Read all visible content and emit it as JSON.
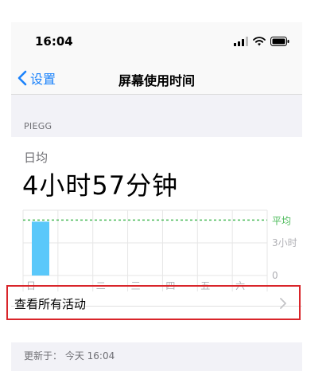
{
  "status_bar": {
    "time": "16:04"
  },
  "nav": {
    "back_label": "设置",
    "title": "屏幕使用时间"
  },
  "section_header": "PIEGG",
  "summary": {
    "label": "日均",
    "value": "4小时57分钟"
  },
  "chart_data": {
    "type": "bar",
    "categories": [
      "日",
      "一",
      "二",
      "三",
      "四",
      "五",
      "六"
    ],
    "values": [
      4.95,
      0,
      0,
      0,
      0,
      0,
      0
    ],
    "average_value": 4.95,
    "average_label": "平均",
    "y_tick_labels": [
      "3小时",
      "0"
    ],
    "ylim": [
      0,
      6
    ],
    "colors": {
      "bar": "#5ac8fa",
      "average_line": "#4cbb5a",
      "grid": "#e6e6e6"
    }
  },
  "view_all": {
    "label": "查看所有活动"
  },
  "updated": {
    "text": "更新于： 今天 16:04"
  }
}
